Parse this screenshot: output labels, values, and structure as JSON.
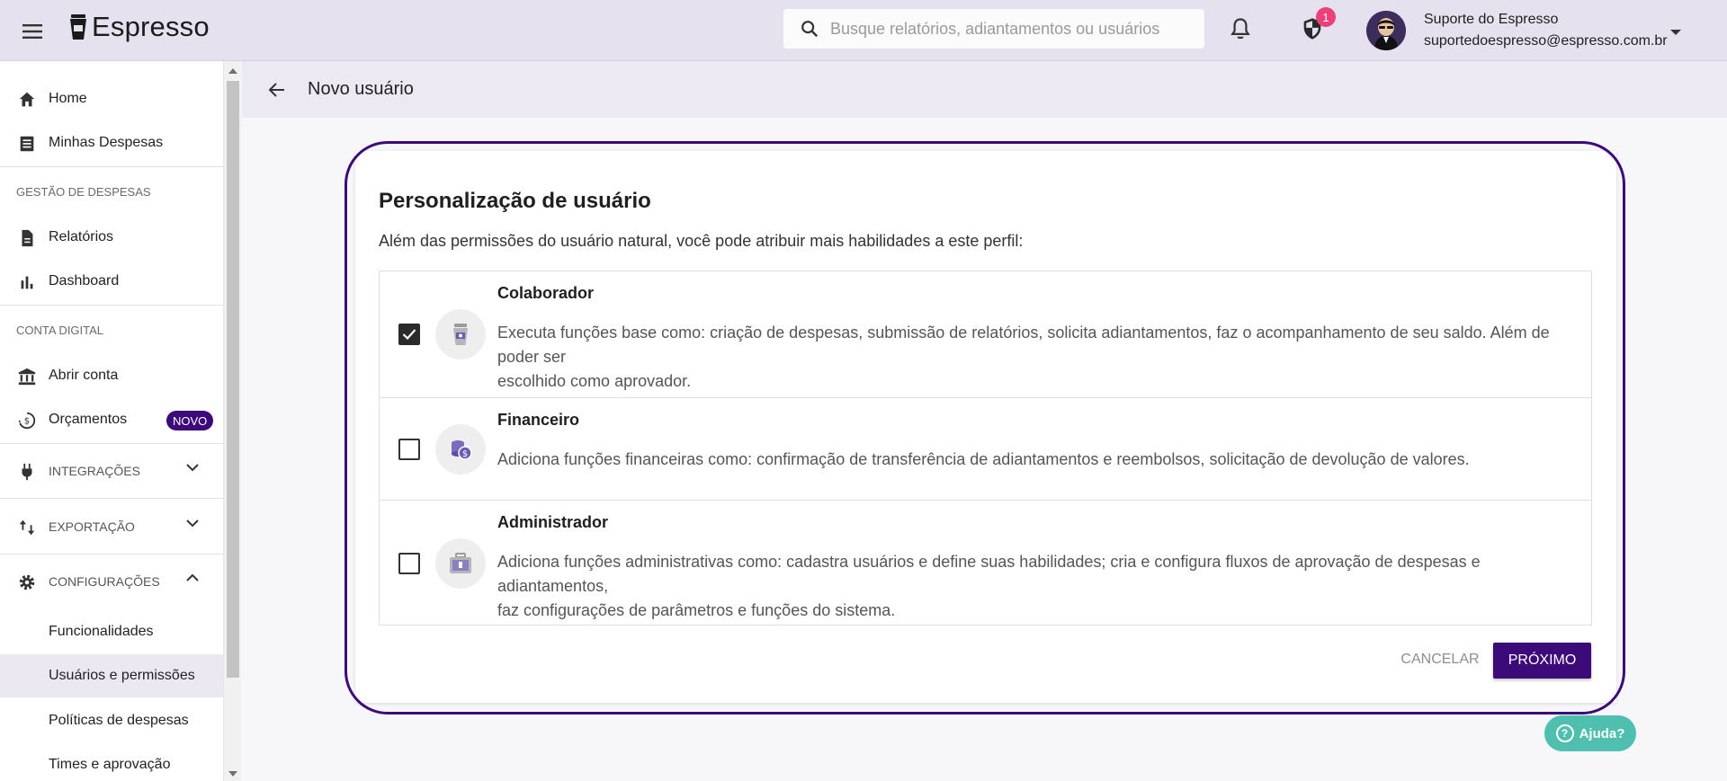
{
  "header": {
    "logo_text": "Espresso",
    "search_placeholder": "Busque relatórios, adiantamentos ou usuários",
    "notification_count": "1",
    "user_name": "Suporte do Espresso",
    "user_email": "suportedoespresso@espresso.com.br"
  },
  "sidebar": {
    "items": [
      {
        "label": "Home",
        "icon": "home-icon"
      },
      {
        "label": "Minhas Despesas",
        "icon": "list-icon"
      }
    ],
    "section_gestao": "GESTÃO DE DESPESAS",
    "gestao_items": [
      {
        "label": "Relatórios",
        "icon": "document-icon"
      },
      {
        "label": "Dashboard",
        "icon": "bar-chart-icon"
      }
    ],
    "section_conta": "CONTA DIGITAL",
    "conta_items": [
      {
        "label": "Abrir conta",
        "icon": "bank-icon"
      },
      {
        "label": "Orçamentos",
        "icon": "budget-icon",
        "badge": "NOVO"
      }
    ],
    "integracoes": "INTEGRAÇÕES",
    "exportacao": "EXPORTAÇÃO",
    "configuracoes": "CONFIGURAÇÕES",
    "config_sub": [
      {
        "label": "Funcionalidades"
      },
      {
        "label": "Usuários e permissões",
        "active": true
      },
      {
        "label": "Políticas de despesas"
      },
      {
        "label": "Times e aprovação"
      }
    ]
  },
  "page": {
    "title": "Novo usuário"
  },
  "card": {
    "title": "Personalização de usuário",
    "subtitle": "Além das permissões do usuário natural, você pode atribuir mais habilidades a este perfil:",
    "options": [
      {
        "title": "Colaborador",
        "checked": true,
        "desc_line1": "Executa funções base como: criação de despesas, submissão de relatórios, solicita adiantamentos, faz o acompanhamento de seu saldo. Além de poder ser",
        "desc_line2": "escolhido como aprovador."
      },
      {
        "title": "Financeiro",
        "checked": false,
        "desc_line1": "Adiciona funções financeiras como: confirmação de transferência de adiantamentos e reembolsos, solicitação de devolução de valores."
      },
      {
        "title": "Administrador",
        "checked": false,
        "desc_line1": "Adiciona funções administrativas como: cadastra usuários e define suas habilidades; cria e configura fluxos de aprovação de despesas e adiantamentos,",
        "desc_line2": "faz configurações de parâmetros e funções do sistema."
      }
    ],
    "cancel_label": "CANCELAR",
    "next_label": "PRÓXIMO"
  },
  "help": {
    "label": "Ajuda?"
  },
  "colors": {
    "brand": "#3d0a79",
    "header_bg": "#e6e1ee",
    "help_bg": "#4fbfb0",
    "badge_pink": "#ec407a"
  }
}
